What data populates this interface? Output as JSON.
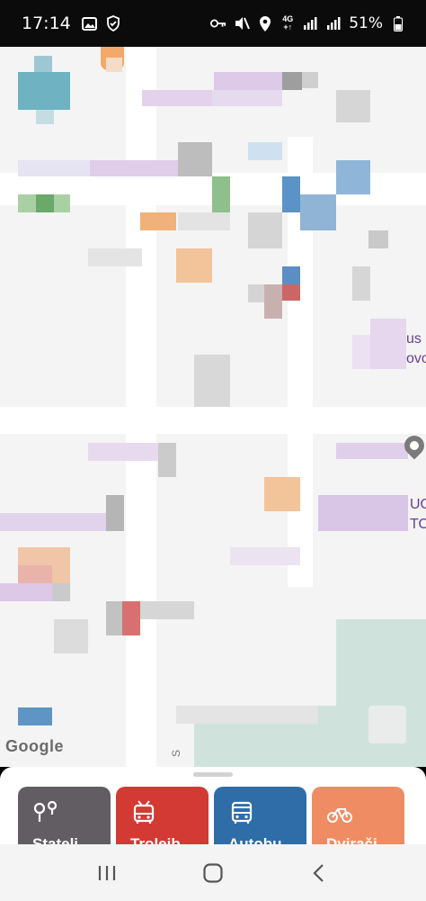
{
  "status_bar": {
    "time": "17:14",
    "network": "4G",
    "network_sub": "+↑",
    "battery": "51%"
  },
  "map": {
    "watermark": "Google",
    "edge_labels": [
      "us",
      "ovo",
      "UO",
      "TO"
    ],
    "street_letter": "S"
  },
  "categories": [
    {
      "label": "Stateli",
      "color": "#625d63",
      "icon": "location-pins-icon"
    },
    {
      "label": "Troleib",
      "color": "#d23a33",
      "icon": "trolleybus-icon"
    },
    {
      "label": "Autobu",
      "color": "#2f6da8",
      "icon": "bus-icon"
    },
    {
      "label": "Dvirači",
      "color": "#ef8c64",
      "icon": "bicycle-icon"
    }
  ],
  "nav": {
    "recents": "recents",
    "home": "home",
    "back": "back"
  }
}
